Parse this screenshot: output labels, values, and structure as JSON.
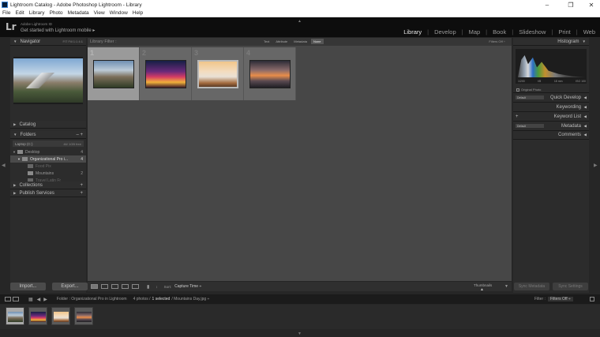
{
  "window": {
    "title": "Lightroom Catalog - Adobe Photoshop Lightroom - Library",
    "controls": [
      "–",
      "❐",
      "✕"
    ]
  },
  "menu": [
    "File",
    "Edit",
    "Library",
    "Photo",
    "Metadata",
    "View",
    "Window",
    "Help"
  ],
  "identity": {
    "logo": "Lr",
    "adobe_id": "Adobe Lightroom ID",
    "mobile_text": "Get started with Lightroom mobile",
    "mobile_arrow": "▸"
  },
  "modules": {
    "items": [
      "Library",
      "Develop",
      "Map",
      "Book",
      "Slideshow",
      "Print",
      "Web"
    ],
    "active": "Library"
  },
  "left_panel": {
    "navigator": {
      "label": "Navigator",
      "zoom": "FIT  Fill  1:1  4:1"
    },
    "catalog": "Catalog",
    "folders": {
      "label": "Folders",
      "volume": "Laptop (C:)",
      "volume_free": "46/ 1GB free",
      "desktop": {
        "name": "Desktop",
        "count": "4"
      },
      "org_folder": {
        "name": "Organizational Pro i...",
        "count": "4"
      },
      "sub1": {
        "name": "Food Pix",
        "count": ""
      },
      "sub2": {
        "name": "Mountains",
        "count": "2"
      },
      "sub3": {
        "name": "Travel Latin Fr",
        "count": ""
      }
    },
    "collections": "Collections",
    "publish_services": "Publish Services",
    "import_button": "Import...",
    "export_button": "Export..."
  },
  "center": {
    "filter_label": "Library Filter :",
    "filter_tabs": [
      "Text",
      "Attribute",
      "Metadata",
      "None"
    ],
    "filter_active": "None",
    "filter_off": "Filters Off ÷",
    "cells": [
      {
        "num": "1",
        "selected": true
      },
      {
        "num": "2",
        "selected": false
      },
      {
        "num": "3",
        "selected": false
      },
      {
        "num": "4",
        "selected": false
      }
    ],
    "sort_label": "Sort:",
    "sort_value": "Capture Time ÷",
    "thumbnails_label": "Thumbnails"
  },
  "right_panel": {
    "histogram": "Histogram",
    "histo_info": [
      "1/200",
      "f/8",
      "18 mm",
      "ISO 100"
    ],
    "original_photo": "Original Photo",
    "quick_develop": {
      "dd": "Default",
      "label": "Quick Develop"
    },
    "keywording": "Keywording",
    "keyword_list": "Keyword List",
    "metadata": {
      "dd": "Default",
      "label": "Metadata"
    },
    "comments": "Comments",
    "sync_metadata": "Sync Metadata",
    "sync_settings": "Sync Settings"
  },
  "filmstrip": {
    "path_prefix": "Folder : Organizational Pro in Lightroom",
    "photo_count": "4 photos /",
    "selected_text": "1 selected",
    "filename": "/ Mountains Day.jpg ÷",
    "filter_label": "Filter :",
    "filter_value": "Filters Off ÷"
  }
}
